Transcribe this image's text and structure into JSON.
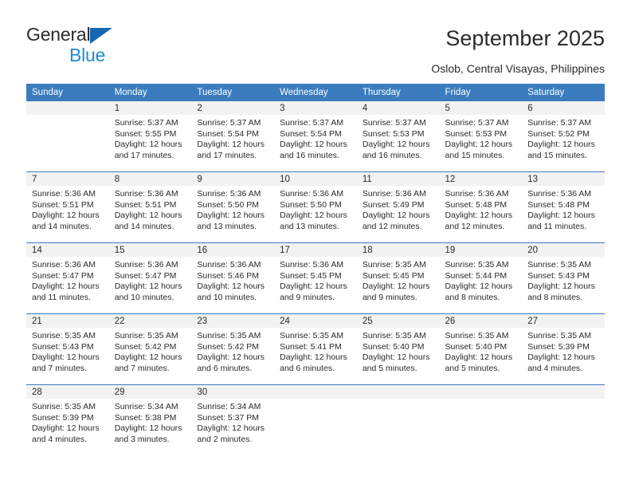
{
  "brand": {
    "line1": "General",
    "line2": "Blue",
    "triangle_color": "#1668b3",
    "blue_text_color": "#1c8ad6"
  },
  "header": {
    "title": "September 2025",
    "location": "Oslob, Central Visayas, Philippines"
  },
  "theme": {
    "header_blue": "#3a7cbe",
    "daynum_band": "#f2f2f2",
    "text": "#2b2b2b"
  },
  "weekday_headers": [
    "Sunday",
    "Monday",
    "Tuesday",
    "Wednesday",
    "Thursday",
    "Friday",
    "Saturday"
  ],
  "weeks": [
    [
      {
        "empty": true
      },
      {
        "day": "1",
        "sunrise": "Sunrise: 5:37 AM",
        "sunset": "Sunset: 5:55 PM",
        "daylight1": "Daylight: 12 hours",
        "daylight2": "and 17 minutes."
      },
      {
        "day": "2",
        "sunrise": "Sunrise: 5:37 AM",
        "sunset": "Sunset: 5:54 PM",
        "daylight1": "Daylight: 12 hours",
        "daylight2": "and 17 minutes."
      },
      {
        "day": "3",
        "sunrise": "Sunrise: 5:37 AM",
        "sunset": "Sunset: 5:54 PM",
        "daylight1": "Daylight: 12 hours",
        "daylight2": "and 16 minutes."
      },
      {
        "day": "4",
        "sunrise": "Sunrise: 5:37 AM",
        "sunset": "Sunset: 5:53 PM",
        "daylight1": "Daylight: 12 hours",
        "daylight2": "and 16 minutes."
      },
      {
        "day": "5",
        "sunrise": "Sunrise: 5:37 AM",
        "sunset": "Sunset: 5:53 PM",
        "daylight1": "Daylight: 12 hours",
        "daylight2": "and 15 minutes."
      },
      {
        "day": "6",
        "sunrise": "Sunrise: 5:37 AM",
        "sunset": "Sunset: 5:52 PM",
        "daylight1": "Daylight: 12 hours",
        "daylight2": "and 15 minutes."
      }
    ],
    [
      {
        "day": "7",
        "sunrise": "Sunrise: 5:36 AM",
        "sunset": "Sunset: 5:51 PM",
        "daylight1": "Daylight: 12 hours",
        "daylight2": "and 14 minutes."
      },
      {
        "day": "8",
        "sunrise": "Sunrise: 5:36 AM",
        "sunset": "Sunset: 5:51 PM",
        "daylight1": "Daylight: 12 hours",
        "daylight2": "and 14 minutes."
      },
      {
        "day": "9",
        "sunrise": "Sunrise: 5:36 AM",
        "sunset": "Sunset: 5:50 PM",
        "daylight1": "Daylight: 12 hours",
        "daylight2": "and 13 minutes."
      },
      {
        "day": "10",
        "sunrise": "Sunrise: 5:36 AM",
        "sunset": "Sunset: 5:50 PM",
        "daylight1": "Daylight: 12 hours",
        "daylight2": "and 13 minutes."
      },
      {
        "day": "11",
        "sunrise": "Sunrise: 5:36 AM",
        "sunset": "Sunset: 5:49 PM",
        "daylight1": "Daylight: 12 hours",
        "daylight2": "and 12 minutes."
      },
      {
        "day": "12",
        "sunrise": "Sunrise: 5:36 AM",
        "sunset": "Sunset: 5:48 PM",
        "daylight1": "Daylight: 12 hours",
        "daylight2": "and 12 minutes."
      },
      {
        "day": "13",
        "sunrise": "Sunrise: 5:36 AM",
        "sunset": "Sunset: 5:48 PM",
        "daylight1": "Daylight: 12 hours",
        "daylight2": "and 11 minutes."
      }
    ],
    [
      {
        "day": "14",
        "sunrise": "Sunrise: 5:36 AM",
        "sunset": "Sunset: 5:47 PM",
        "daylight1": "Daylight: 12 hours",
        "daylight2": "and 11 minutes."
      },
      {
        "day": "15",
        "sunrise": "Sunrise: 5:36 AM",
        "sunset": "Sunset: 5:47 PM",
        "daylight1": "Daylight: 12 hours",
        "daylight2": "and 10 minutes."
      },
      {
        "day": "16",
        "sunrise": "Sunrise: 5:36 AM",
        "sunset": "Sunset: 5:46 PM",
        "daylight1": "Daylight: 12 hours",
        "daylight2": "and 10 minutes."
      },
      {
        "day": "17",
        "sunrise": "Sunrise: 5:36 AM",
        "sunset": "Sunset: 5:45 PM",
        "daylight1": "Daylight: 12 hours",
        "daylight2": "and 9 minutes."
      },
      {
        "day": "18",
        "sunrise": "Sunrise: 5:35 AM",
        "sunset": "Sunset: 5:45 PM",
        "daylight1": "Daylight: 12 hours",
        "daylight2": "and 9 minutes."
      },
      {
        "day": "19",
        "sunrise": "Sunrise: 5:35 AM",
        "sunset": "Sunset: 5:44 PM",
        "daylight1": "Daylight: 12 hours",
        "daylight2": "and 8 minutes."
      },
      {
        "day": "20",
        "sunrise": "Sunrise: 5:35 AM",
        "sunset": "Sunset: 5:43 PM",
        "daylight1": "Daylight: 12 hours",
        "daylight2": "and 8 minutes."
      }
    ],
    [
      {
        "day": "21",
        "sunrise": "Sunrise: 5:35 AM",
        "sunset": "Sunset: 5:43 PM",
        "daylight1": "Daylight: 12 hours",
        "daylight2": "and 7 minutes."
      },
      {
        "day": "22",
        "sunrise": "Sunrise: 5:35 AM",
        "sunset": "Sunset: 5:42 PM",
        "daylight1": "Daylight: 12 hours",
        "daylight2": "and 7 minutes."
      },
      {
        "day": "23",
        "sunrise": "Sunrise: 5:35 AM",
        "sunset": "Sunset: 5:42 PM",
        "daylight1": "Daylight: 12 hours",
        "daylight2": "and 6 minutes."
      },
      {
        "day": "24",
        "sunrise": "Sunrise: 5:35 AM",
        "sunset": "Sunset: 5:41 PM",
        "daylight1": "Daylight: 12 hours",
        "daylight2": "and 6 minutes."
      },
      {
        "day": "25",
        "sunrise": "Sunrise: 5:35 AM",
        "sunset": "Sunset: 5:40 PM",
        "daylight1": "Daylight: 12 hours",
        "daylight2": "and 5 minutes."
      },
      {
        "day": "26",
        "sunrise": "Sunrise: 5:35 AM",
        "sunset": "Sunset: 5:40 PM",
        "daylight1": "Daylight: 12 hours",
        "daylight2": "and 5 minutes."
      },
      {
        "day": "27",
        "sunrise": "Sunrise: 5:35 AM",
        "sunset": "Sunset: 5:39 PM",
        "daylight1": "Daylight: 12 hours",
        "daylight2": "and 4 minutes."
      }
    ],
    [
      {
        "day": "28",
        "sunrise": "Sunrise: 5:35 AM",
        "sunset": "Sunset: 5:39 PM",
        "daylight1": "Daylight: 12 hours",
        "daylight2": "and 4 minutes."
      },
      {
        "day": "29",
        "sunrise": "Sunrise: 5:34 AM",
        "sunset": "Sunset: 5:38 PM",
        "daylight1": "Daylight: 12 hours",
        "daylight2": "and 3 minutes."
      },
      {
        "day": "30",
        "sunrise": "Sunrise: 5:34 AM",
        "sunset": "Sunset: 5:37 PM",
        "daylight1": "Daylight: 12 hours",
        "daylight2": "and 2 minutes."
      },
      {
        "empty": true
      },
      {
        "empty": true
      },
      {
        "empty": true
      },
      {
        "empty": true
      }
    ]
  ]
}
